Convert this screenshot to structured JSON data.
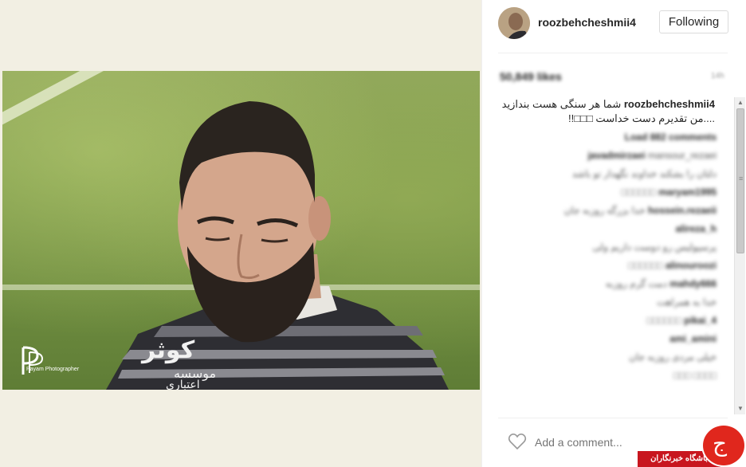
{
  "post": {
    "username": "roozbehcheshmii4",
    "follow_label": "Following",
    "likes": "50,849 likes",
    "time_ago": "14h",
    "caption_user": "roozbehcheshmii4",
    "caption_text": "شما هر سنگی هست بندازید ....من تقدیرم دست خداست □□□!!"
  },
  "watermark": {
    "text": "Payam Photographer"
  },
  "shirt_text": "موسسه اعتباری کوثر",
  "comments": [
    {
      "user": "Load 882 comments",
      "text": ""
    },
    {
      "user": "javadmirzaei",
      "text": "mansour_rezaei"
    },
    {
      "user": "",
      "text": "دلتان را بشکند خداوند نگهدار تو باشد"
    },
    {
      "user": "maryam1995",
      "text": "□□□□□□"
    },
    {
      "user": "hossein.rezaeii",
      "text": "خدا بزرگه روزبه جان"
    },
    {
      "user": "alireza_h",
      "text": ""
    },
    {
      "user": "",
      "text": "پرسپولیس رو دوست داریم ولی"
    },
    {
      "user": "alinouroozi",
      "text": "□□□□□□"
    },
    {
      "user": "mahdy666",
      "text": "دمت گرم روزبه"
    },
    {
      "user": "",
      "text": "خدا به همراهت"
    },
    {
      "user": "pikai_4",
      "text": "□□□□□□"
    },
    {
      "user": "ami_amini",
      "text": ""
    },
    {
      "user": "",
      "text": "خیلی مردی روزبه جان"
    },
    {
      "user": "",
      "text": "□□□□ □□□"
    }
  ],
  "add_comment_placeholder": "Add a comment...",
  "logo": {
    "band_text": "باشگاه خبرنگاران"
  },
  "colors": {
    "accent_red": "#e0271d",
    "field_green": "#7d9a49"
  },
  "icons": [
    "heart-icon",
    "avatar",
    "scroll-up-icon",
    "scroll-down-icon"
  ]
}
